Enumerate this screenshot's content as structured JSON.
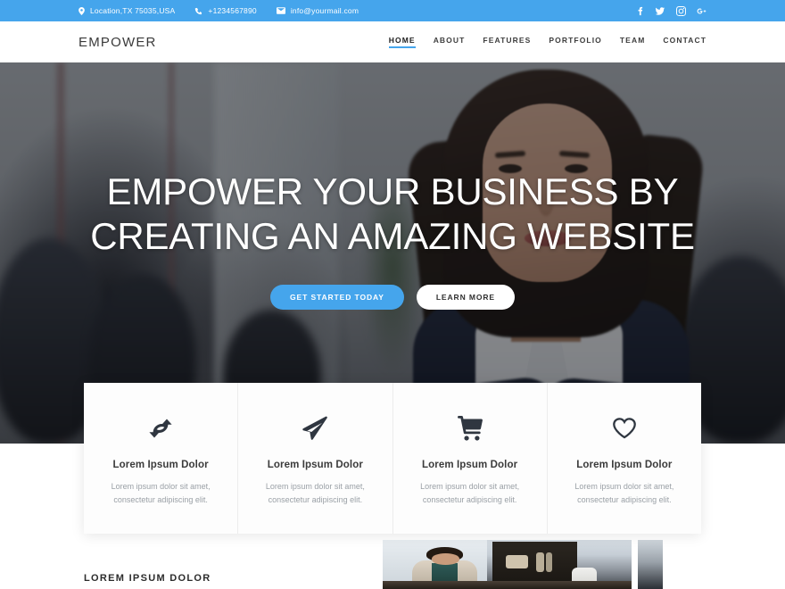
{
  "topbar": {
    "contacts": [
      {
        "icon": "map-marker-icon",
        "text": "Location,TX 75035,USA"
      },
      {
        "icon": "phone-icon",
        "text": "+1234567890"
      },
      {
        "icon": "envelope-icon",
        "text": "info@yourmail.com"
      }
    ],
    "social": [
      {
        "name": "facebook-icon",
        "label": "f"
      },
      {
        "name": "twitter-icon",
        "label": "t"
      },
      {
        "name": "instagram-icon",
        "label": "i"
      },
      {
        "name": "google-plus-icon",
        "label": "g+"
      }
    ],
    "background_color": "#45a5ec"
  },
  "navbar": {
    "logo": "EMPOWER",
    "links": [
      {
        "label": "HOME",
        "active": true
      },
      {
        "label": "ABOUT",
        "active": false
      },
      {
        "label": "FEATURES",
        "active": false
      },
      {
        "label": "PORTFOLIO",
        "active": false
      },
      {
        "label": "TEAM",
        "active": false
      },
      {
        "label": "CONTACT",
        "active": false
      }
    ],
    "active_underline_color": "#45a5ec"
  },
  "hero": {
    "title": "EMPOWER YOUR BUSINESS BY CREATING AN AMAZING WEBSITE",
    "primary_button": "GET STARTED TODAY",
    "secondary_button": "LEARN MORE",
    "primary_button_color": "#45a5ec",
    "secondary_button_color": "#ffffff"
  },
  "features": [
    {
      "icon": "refresh-icon",
      "title": "Lorem Ipsum Dolor",
      "desc": "Lorem ipsum dolor sit amet, consectetur adipiscing elit."
    },
    {
      "icon": "paper-plane-icon",
      "title": "Lorem Ipsum Dolor",
      "desc": "Lorem ipsum dolor sit amet, consectetur adipiscing elit."
    },
    {
      "icon": "shopping-cart-icon",
      "title": "Lorem Ipsum Dolor",
      "desc": "Lorem ipsum dolor sit amet, consectetur adipiscing elit."
    },
    {
      "icon": "heart-icon",
      "title": "Lorem Ipsum Dolor",
      "desc": "Lorem ipsum dolor sit amet, consectetur adipiscing elit."
    }
  ],
  "about": {
    "kicker": "LOREM IPSUM DOLOR"
  }
}
